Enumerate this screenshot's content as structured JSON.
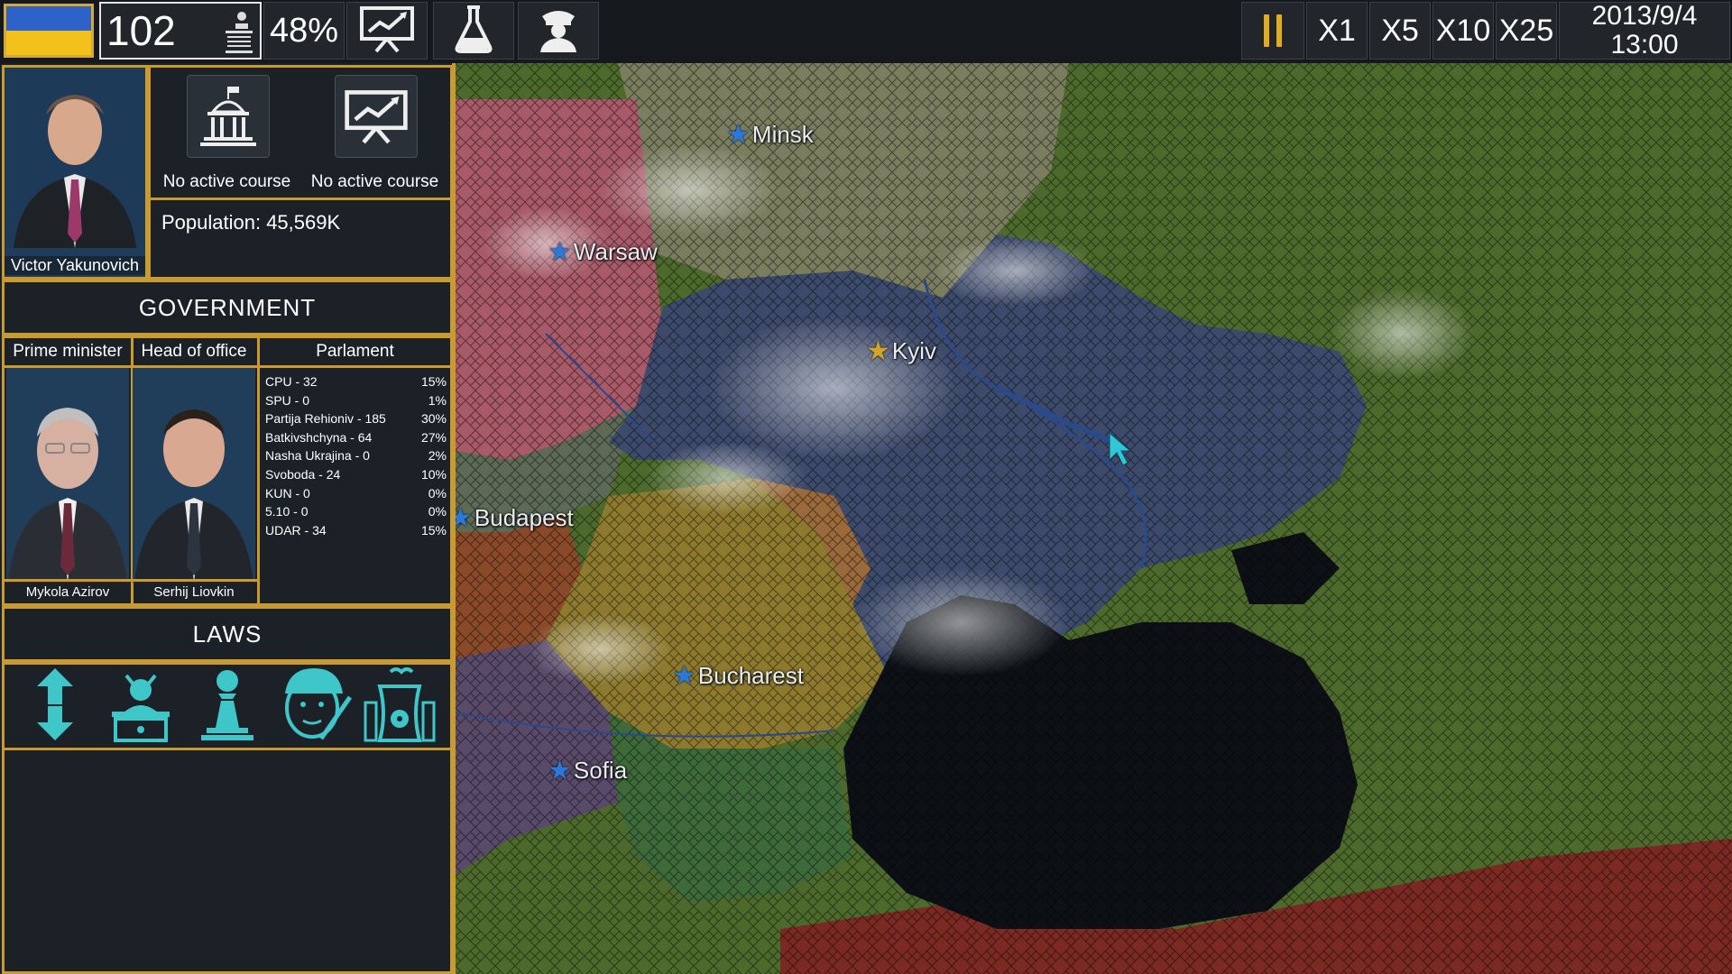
{
  "topbar": {
    "stat_value": "102",
    "approval": "48%",
    "speeds": [
      "X1",
      "X5",
      "X10",
      "X25"
    ],
    "date": "2013/9/4",
    "time": "13:00"
  },
  "leader": {
    "name": "Victor Yakunovich"
  },
  "courses": [
    {
      "label": "No active course",
      "icon": "parliament-building-icon"
    },
    {
      "label": "No active course",
      "icon": "economy-chart-icon"
    }
  ],
  "population": "Population: 45,569K",
  "government": {
    "title": "GOVERNMENT",
    "prime_minister": {
      "role": "Prime minister",
      "name": "Mykola Azirov"
    },
    "head_of_office": {
      "role": "Head of office",
      "name": "Serhij Liovkin"
    },
    "parliament": {
      "title": "Parlament",
      "parties": [
        {
          "name": "CPU - 32",
          "pct": "15%"
        },
        {
          "name": "SPU - 0",
          "pct": "1%"
        },
        {
          "name": "Partija Rehioniv - 185",
          "pct": "30%"
        },
        {
          "name": "Batkivshchyna - 64",
          "pct": "27%"
        },
        {
          "name": "Nasha Ukrajina - 0",
          "pct": "2%"
        },
        {
          "name": "Svoboda - 24",
          "pct": "10%"
        },
        {
          "name": "KUN - 0",
          "pct": "0%"
        },
        {
          "name": "5.10 - 0",
          "pct": "0%"
        },
        {
          "name": "UDAR - 34",
          "pct": "15%"
        }
      ]
    }
  },
  "laws": {
    "title": "LAWS",
    "icons": [
      "tax-arrows-icon",
      "corruption-devil-icon",
      "pawn-icon",
      "conscription-soldier-icon",
      "nuclear-plant-icon"
    ]
  },
  "map": {
    "cities": [
      {
        "name": "Minsk",
        "capital": false
      },
      {
        "name": "Warsaw",
        "capital": false
      },
      {
        "name": "Kyiv",
        "capital": true
      },
      {
        "name": "Budapest",
        "capital": false
      },
      {
        "name": "Bucharest",
        "capital": false
      },
      {
        "name": "Sofia",
        "capital": false
      }
    ]
  },
  "colors": {
    "accent_gold": "#c99a2e",
    "ukraine_blue": "#2f62c9",
    "ukraine_yellow": "#f2c21b",
    "law_icon_cyan": "#3ec6c9"
  }
}
